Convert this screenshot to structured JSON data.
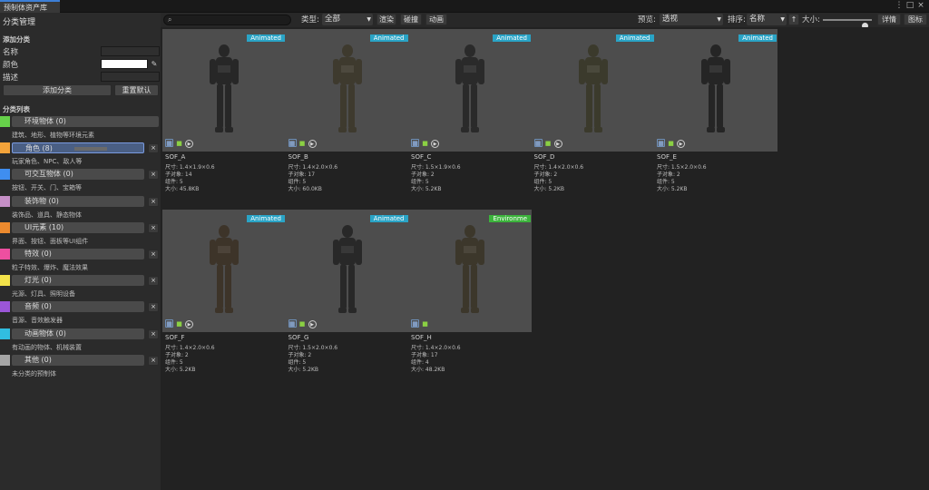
{
  "window": {
    "tab_title": "预制体资产库",
    "menu_icon": "kebab-icon",
    "maximize_icon": "maximize-icon",
    "close_icon": "close-icon"
  },
  "sidebar": {
    "title": "分类管理",
    "add_section": {
      "title": "添加分类",
      "name_label": "名称",
      "color_label": "颜色",
      "desc_label": "描述",
      "add_button": "添加分类",
      "reset_button": "重置默认"
    },
    "list_title": "分类列表",
    "categories": [
      {
        "label": "环境物体 (0)",
        "desc": "建筑、地形、植物等环境元素",
        "color": "#66d14a",
        "selected": false,
        "removable": false
      },
      {
        "label": "角色 (8)",
        "desc": "玩家角色、NPC、敌人等",
        "color": "#f3a33a",
        "selected": true,
        "removable": true
      },
      {
        "label": "可交互物体 (0)",
        "desc": "按钮、开关、门、宝箱等",
        "color": "#3f8ef0",
        "selected": false,
        "removable": true
      },
      {
        "label": "装饰物 (0)",
        "desc": "装饰品、道具、静态物体",
        "color": "#c58fc6",
        "selected": false,
        "removable": true
      },
      {
        "label": "UI元素 (10)",
        "desc": "界面、按钮、面板等UI组件",
        "color": "#ec8a2e",
        "selected": false,
        "removable": true
      },
      {
        "label": "特效 (0)",
        "desc": "粒子特效、爆炸、魔法效果",
        "color": "#ee4fa0",
        "selected": false,
        "removable": true
      },
      {
        "label": "灯光 (0)",
        "desc": "光源、灯具、照明设备",
        "color": "#f3e24a",
        "selected": false,
        "removable": true
      },
      {
        "label": "音频 (0)",
        "desc": "音源、音效触发器",
        "color": "#9b56d8",
        "selected": false,
        "removable": true
      },
      {
        "label": "动画物体 (0)",
        "desc": "有动画的物体、机械装置",
        "color": "#31bde0",
        "selected": false,
        "removable": true
      },
      {
        "label": "其他 (0)",
        "desc": "未分类的预制体",
        "color": "#a5a5a5",
        "selected": false,
        "removable": true
      }
    ],
    "remove_label": "×"
  },
  "toolbar": {
    "search_placeholder": "",
    "search_icon": "search-icon",
    "type_label": "类型:",
    "type_value": "全部",
    "render_button": "渲染",
    "collision_button": "碰撞",
    "animation_button": "动画",
    "preview_label": "预览:",
    "preview_value": "透视",
    "sort_label": "排序:",
    "sort_value": "名称",
    "sort_dir": "↑",
    "size_label": "大小:",
    "size_slider": 0.85,
    "details_button": "详情",
    "icon_button": "图标"
  },
  "colors": {
    "animated_badge": "#2aa4c6",
    "environment_badge": "#3cb43c",
    "accent": "#3d7fd6"
  },
  "assets": [
    {
      "name": "SOF_A",
      "badge": "Animated",
      "badge_kind": "animated",
      "size": "尺寸: 1.4×1.9×0.6",
      "children": "子对象: 14",
      "components": "组件: 5",
      "filesize": "大小: 45.8KB",
      "play": true,
      "figure_color": "#272727"
    },
    {
      "name": "SOF_B",
      "badge": "Animated",
      "badge_kind": "animated",
      "size": "尺寸: 1.4×2.0×0.6",
      "children": "子对象: 17",
      "components": "组件: 5",
      "filesize": "大小: 60.0KB",
      "play": true,
      "figure_color": "#3e3a2e"
    },
    {
      "name": "SOF_C",
      "badge": "Animated",
      "badge_kind": "animated",
      "size": "尺寸: 1.5×1.9×0.6",
      "children": "子对象: 2",
      "components": "组件: 5",
      "filesize": "大小: 5.2KB",
      "play": true,
      "figure_color": "#2a2a2a"
    },
    {
      "name": "SOF_D",
      "badge": "Animated",
      "badge_kind": "animated",
      "size": "尺寸: 1.4×2.0×0.6",
      "children": "子对象: 2",
      "components": "组件: 5",
      "filesize": "大小: 5.2KB",
      "play": true,
      "figure_color": "#3b3a2c"
    },
    {
      "name": "SOF_E",
      "badge": "Animated",
      "badge_kind": "animated",
      "size": "尺寸: 1.5×2.0×0.6",
      "children": "子对象: 2",
      "components": "组件: 5",
      "filesize": "大小: 5.2KB",
      "play": true,
      "figure_color": "#252525"
    },
    {
      "name": "SOF_F",
      "badge": "Animated",
      "badge_kind": "animated",
      "size": "尺寸: 1.4×2.0×0.6",
      "children": "子对象: 2",
      "components": "组件: 5",
      "filesize": "大小: 5.2KB",
      "play": true,
      "figure_color": "#3d3429"
    },
    {
      "name": "SOF_G",
      "badge": "Animated",
      "badge_kind": "animated",
      "size": "尺寸: 1.5×2.0×0.6",
      "children": "子对象: 2",
      "components": "组件: 5",
      "filesize": "大小: 5.2KB",
      "play": true,
      "figure_color": "#282828"
    },
    {
      "name": "SOF_H",
      "badge": "Environme",
      "badge_kind": "environment",
      "size": "尺寸: 1.4×2.0×0.6",
      "children": "子对象: 17",
      "components": "组件: 4",
      "filesize": "大小: 48.2KB",
      "play": false,
      "figure_color": "#3c372b"
    }
  ]
}
